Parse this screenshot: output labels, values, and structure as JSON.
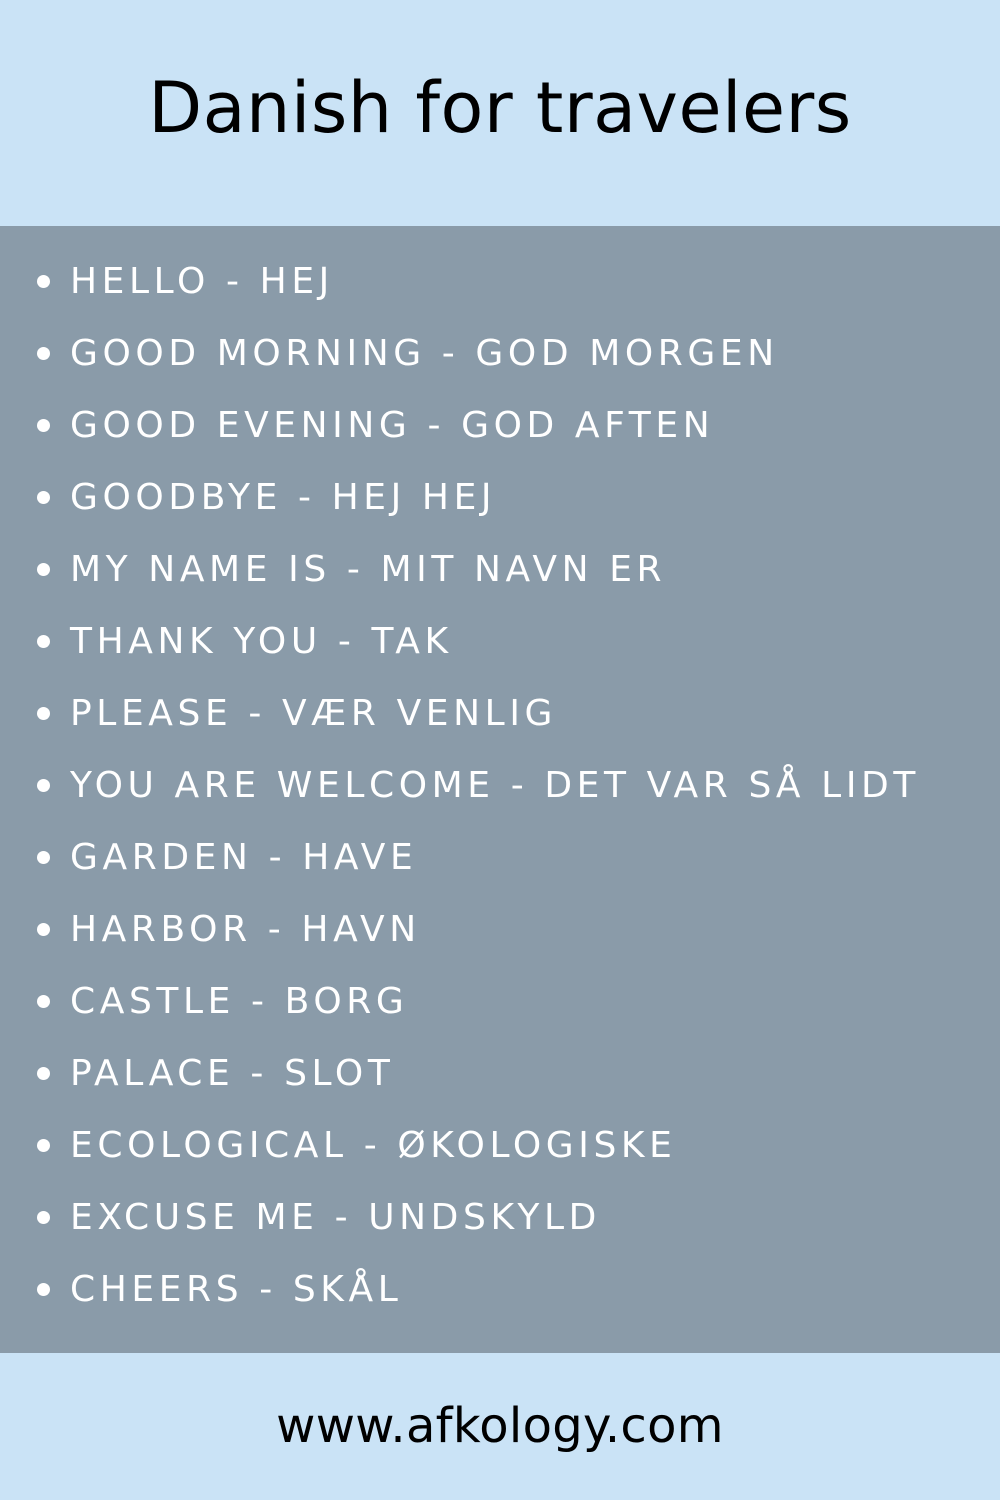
{
  "header": {
    "title": "Danish for travelers"
  },
  "phrases": [
    "HELLO - HEJ",
    "GOOD MORNING - GOD MORGEN",
    "GOOD EVENING - GOD AFTEN",
    "GOODBYE - HEJ HEJ",
    "MY NAME IS - MIT NAVN ER",
    "THANK YOU - TAK",
    "PLEASE - VÆR VENLIG",
    "YOU ARE WELCOME - DET VAR SÅ LIDT",
    "GARDEN - HAVE",
    "HARBOR - HAVN",
    "CASTLE - BORG",
    "PALACE - SLOT",
    "ECOLOGICAL - ØKOLOGISKE",
    "EXCUSE ME - UNDSKYLD",
    "CHEERS - SKÅL"
  ],
  "footer": {
    "url": "www.afkology.com"
  },
  "colors": {
    "light_blue": "#cae3f6",
    "panel_gray_blue": "#8a9ba9",
    "text_dark": "#000000",
    "text_light": "#ffffff"
  }
}
